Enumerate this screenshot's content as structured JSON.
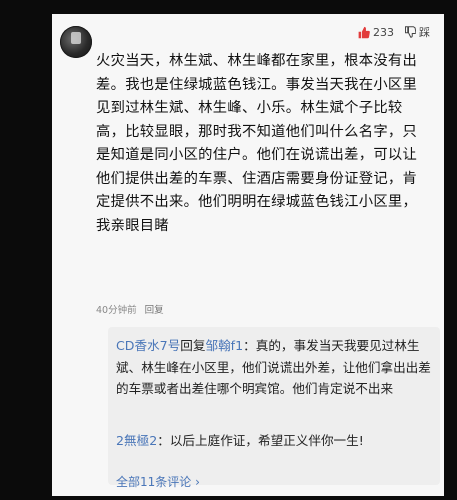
{
  "comment": {
    "likes": "233",
    "dislike_label": "踩",
    "text": "火灾当天，林生斌、林生峰都在家里，根本没有出差。我也是住绿城蓝色钱江。事发当天我在小区里见到过林生斌、林生峰、小乐。林生斌个子比较高，比较显眼，那时我不知道他们叫什么名字，只是知道是同小区的住户。他们在说谎出差，可以让他们提供出差的车票、住酒店需要身份证登记，肯定提供不出来。他们明明在绿城蓝色钱江小区里，我亲眼目睹",
    "time": "40分钟前",
    "reply_label": "回复"
  },
  "replies": [
    {
      "user": "CD香水7号",
      "mid": "回复",
      "target": "邹翰f1",
      "text": "：真的，事发当天我要见过林生斌、林生峰在小区里，他们说谎出外差，让他们拿出出差的车票或者出差住哪个明宾馆。他们肯定说不出来"
    },
    {
      "user": "2無極2",
      "text": "：以后上庭作证，希望正义伴你一生!"
    }
  ],
  "all_comments_label": "全部11条评论 ›",
  "colors": {
    "like": "#e23c3c",
    "link": "#4a76b8"
  },
  "icons": {
    "like": "thumbs-up-icon",
    "dislike": "thumbs-down-icon",
    "avatar": "user-avatar"
  }
}
